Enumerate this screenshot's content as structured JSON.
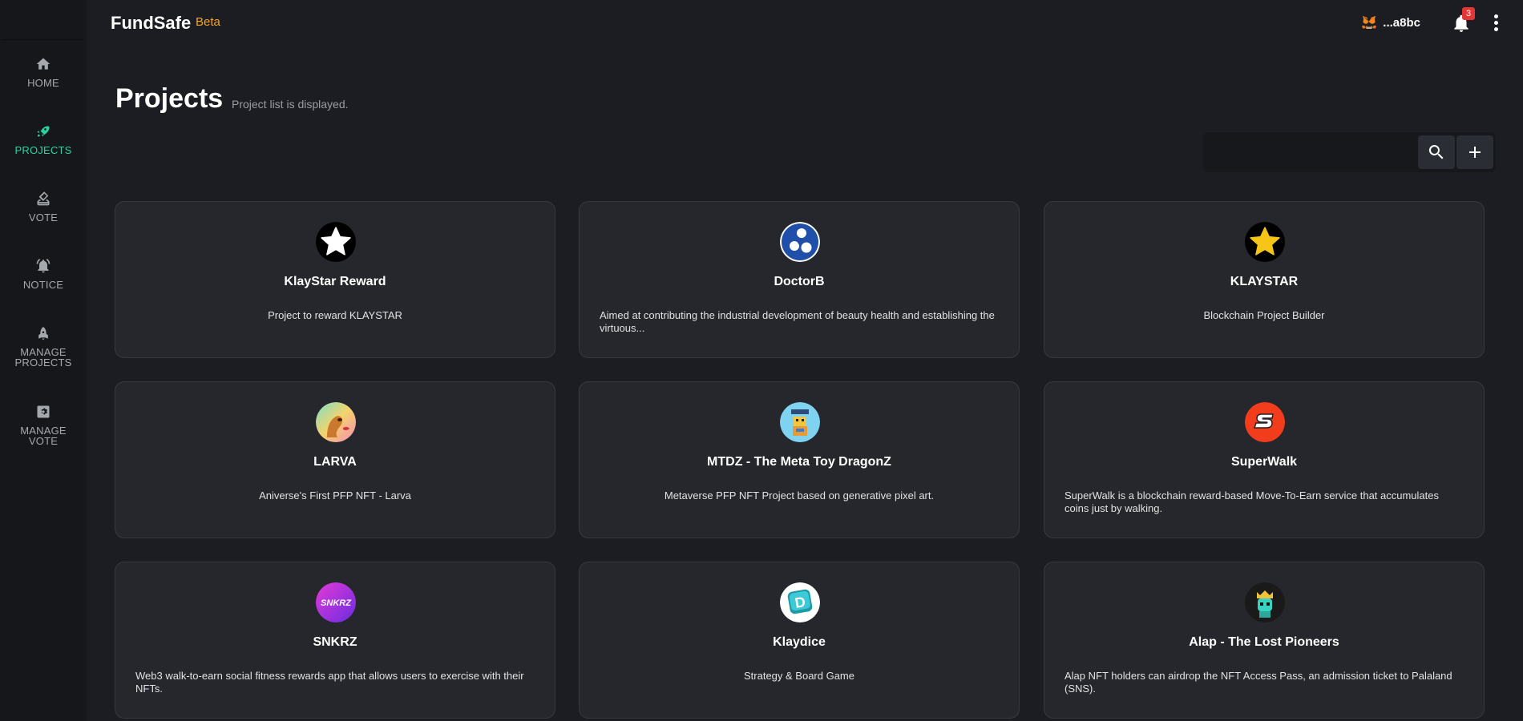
{
  "app": {
    "brand": "FundSafe",
    "beta": "Beta"
  },
  "colors": {
    "accent": "#2bd2a1",
    "beta": "#f2a622",
    "badge": "#e53535"
  },
  "nav": [
    {
      "label": "HOME",
      "icon": "home-icon"
    },
    {
      "label": "PROJECTS",
      "icon": "rocket-icon",
      "active": true
    },
    {
      "label": "VOTE",
      "icon": "ballot-icon"
    },
    {
      "label": "NOTICE",
      "icon": "alarm-icon"
    },
    {
      "label_lines": [
        "MANAGE",
        "PROJECTS"
      ],
      "icon": "rocket-outline-icon"
    },
    {
      "label_lines": [
        "MANAGE",
        "VOTE"
      ],
      "icon": "settings-box-icon"
    }
  ],
  "header": {
    "wallet": "...a8bc",
    "wallet_icon": "metamask-fox-icon",
    "notifications": "3"
  },
  "page": {
    "title": "Projects",
    "subtitle": "Project list is displayed."
  },
  "search": {
    "placeholder": "",
    "value": ""
  },
  "projects": [
    {
      "name": "KlayStar Reward",
      "description": "Project to reward KLAYSTAR",
      "logo": "white-star-logo"
    },
    {
      "name": "DoctorB",
      "description": "Aimed at contributing the industrial development of beauty health and establishing the virtuous...",
      "logo": "doctorb-logo"
    },
    {
      "name": "KLAYSTAR",
      "description": "Blockchain Project Builder",
      "logo": "gold-star-logo"
    },
    {
      "name": "LARVA",
      "description": "Aniverse's First PFP NFT - Larva",
      "logo": "larva-logo"
    },
    {
      "name": "MTDZ - The Meta Toy DragonZ",
      "description": "Metaverse PFP NFT Project based on generative pixel art.",
      "logo": "mtdz-logo"
    },
    {
      "name": "SuperWalk",
      "description": "SuperWalk is a blockchain reward-based Move-To-Earn service that accumulates coins just by walking.",
      "logo": "superwalk-logo"
    },
    {
      "name": "SNKRZ",
      "description": "Web3 walk-to-earn social fitness rewards app that allows users to exercise with their NFTs.",
      "logo": "snkrz-logo",
      "logo_text": "SNKRZ"
    },
    {
      "name": "Klaydice",
      "description": "Strategy & Board Game",
      "logo": "klaydice-logo",
      "logo_text": "D"
    },
    {
      "name": "Alap - The Lost Pioneers",
      "description": "Alap NFT holders can airdrop the NFT Access Pass, an admission ticket to Palaland (SNS).",
      "logo": "alap-logo"
    }
  ]
}
